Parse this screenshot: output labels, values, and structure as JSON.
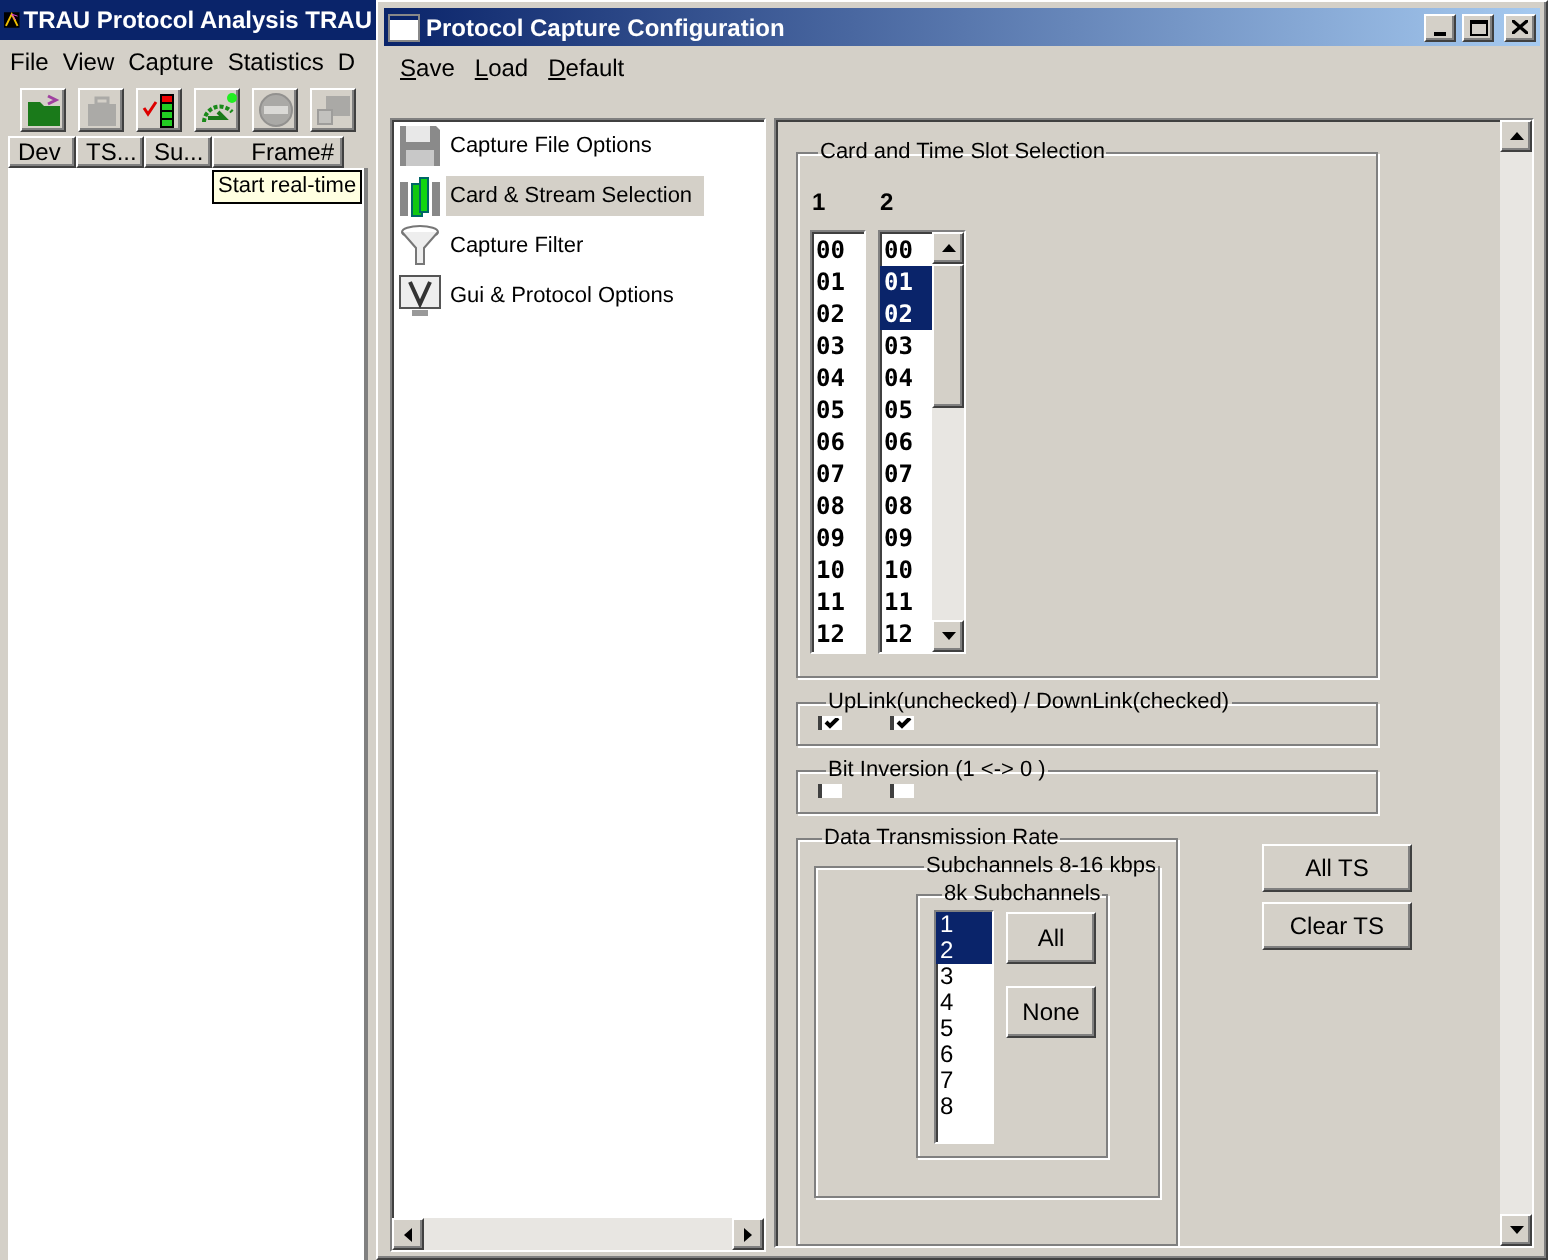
{
  "background_app": {
    "title": "TRAU Protocol Analysis TRAU",
    "menu": [
      "File",
      "View",
      "Capture",
      "Statistics",
      "D"
    ],
    "toolbar": [
      {
        "kind": "open",
        "disabled": false
      },
      {
        "kind": "case",
        "disabled": true
      },
      {
        "kind": "meter",
        "disabled": false
      },
      {
        "kind": "gauge",
        "disabled": false
      },
      {
        "kind": "stop",
        "disabled": true
      },
      {
        "kind": "link",
        "disabled": true
      }
    ],
    "columns": [
      "Dev",
      "TS...",
      "Su...",
      "Frame#"
    ],
    "tooltip": "Start real-time"
  },
  "dialog": {
    "title": "Protocol Capture Configuration",
    "menu": [
      "Save",
      "Load",
      "Default"
    ],
    "tree": [
      {
        "label": "Capture File Options",
        "kind": "floppy",
        "selected": false
      },
      {
        "label": "Card & Stream Selection",
        "kind": "cards",
        "selected": true
      },
      {
        "label": "Capture Filter",
        "kind": "funnel",
        "selected": false
      },
      {
        "label": "Gui & Protocol Options",
        "kind": "monitor",
        "selected": false
      }
    ],
    "card_slot_group": {
      "title": "Card and Time Slot Selection",
      "lists": [
        {
          "label": "1",
          "scrollbar": false,
          "items": [
            {
              "text": "00",
              "selected": false
            },
            {
              "text": "01",
              "selected": false
            },
            {
              "text": "02",
              "selected": false
            },
            {
              "text": "03",
              "selected": false
            },
            {
              "text": "04",
              "selected": false
            },
            {
              "text": "05",
              "selected": false
            },
            {
              "text": "06",
              "selected": false
            },
            {
              "text": "07",
              "selected": false
            },
            {
              "text": "08",
              "selected": false
            },
            {
              "text": "09",
              "selected": false
            },
            {
              "text": "10",
              "selected": false
            },
            {
              "text": "11",
              "selected": false
            },
            {
              "text": "12",
              "selected": false
            }
          ]
        },
        {
          "label": "2",
          "scrollbar": true,
          "items": [
            {
              "text": "00",
              "selected": false
            },
            {
              "text": "01",
              "selected": true
            },
            {
              "text": "02",
              "selected": true
            },
            {
              "text": "03",
              "selected": false
            },
            {
              "text": "04",
              "selected": false
            },
            {
              "text": "05",
              "selected": false
            },
            {
              "text": "06",
              "selected": false
            },
            {
              "text": "07",
              "selected": false
            },
            {
              "text": "08",
              "selected": false
            },
            {
              "text": "09",
              "selected": false
            },
            {
              "text": "10",
              "selected": false
            },
            {
              "text": "11",
              "selected": false
            },
            {
              "text": "12",
              "selected": false
            }
          ]
        }
      ]
    },
    "uplink_group": {
      "title": "UpLink(unchecked) / DownLink(checked)",
      "checkboxes": [
        {
          "checked": true
        },
        {
          "checked": true
        }
      ]
    },
    "bit_inversion_group": {
      "title": "Bit Inversion (1 <-> 0 )",
      "checkboxes": [
        {
          "checked": false
        },
        {
          "checked": false
        }
      ]
    },
    "rate_group": {
      "title": "Data Transmission Rate",
      "subgroup": {
        "title": "Subchannels 8-16 kbps",
        "inner": {
          "title": "8k Subchannels",
          "items": [
            {
              "text": "1",
              "selected": true
            },
            {
              "text": "2",
              "selected": true
            },
            {
              "text": "3",
              "selected": false
            },
            {
              "text": "4",
              "selected": false
            },
            {
              "text": "5",
              "selected": false
            },
            {
              "text": "6",
              "selected": false
            },
            {
              "text": "7",
              "selected": false
            },
            {
              "text": "8",
              "selected": false
            }
          ],
          "buttons": [
            "All",
            "None"
          ]
        }
      }
    },
    "side_buttons": [
      "All TS",
      "Clear TS"
    ]
  }
}
